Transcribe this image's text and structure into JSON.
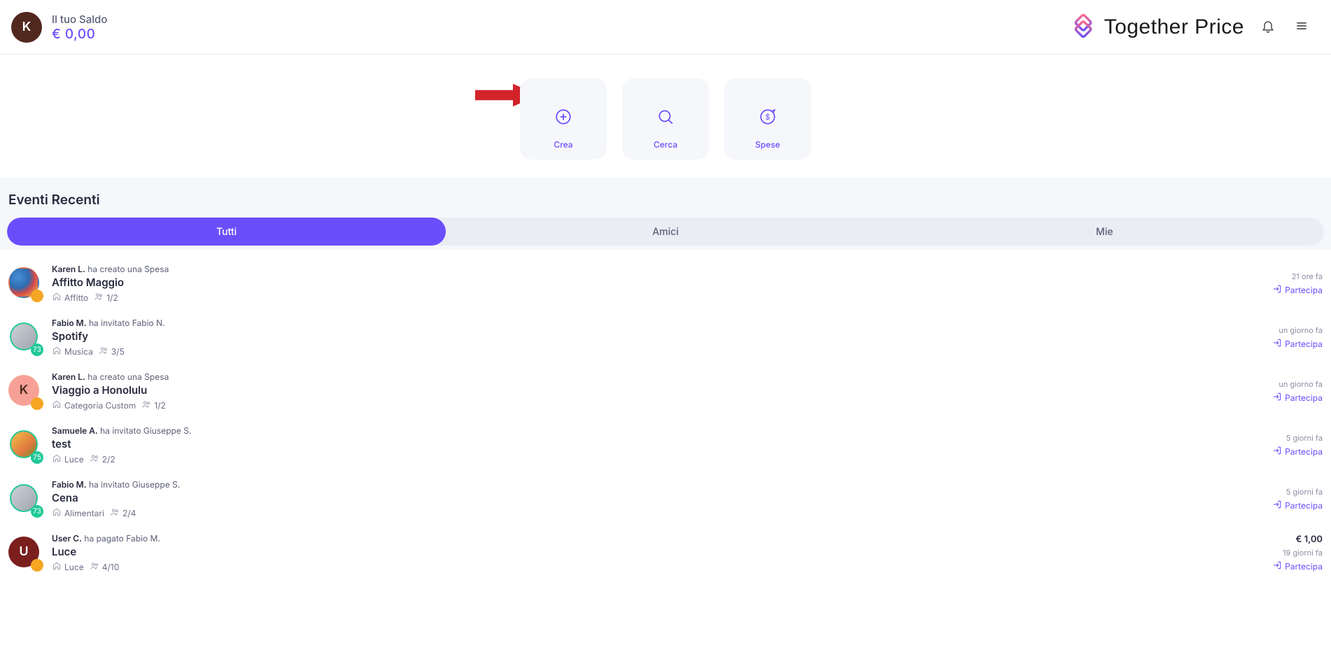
{
  "header": {
    "avatar_initial": "K",
    "balance_label": "Il tuo Saldo",
    "balance_value": "€ 0,00",
    "brand": "Together Price"
  },
  "actions": {
    "create": "Crea",
    "search": "Cerca",
    "expenses": "Spese"
  },
  "events": {
    "section_title": "Eventi Recenti",
    "tabs": {
      "all": "Tutti",
      "friends": "Amici",
      "mine": "Mie"
    },
    "participate_label": "Partecipa",
    "items": [
      {
        "actor": "Karen L.",
        "verb": "ha creato una Spesa",
        "title": "Affitto Maggio",
        "category": "Affitto",
        "members": "1/2",
        "time": "21 ore fa",
        "avatar_style": "img1",
        "badge_style": "orange",
        "badge_text": ""
      },
      {
        "actor": "Fabio M.",
        "verb": "ha invitato Fabio N.",
        "title": "Spotify",
        "category": "Musica",
        "members": "3/5",
        "time": "un giorno fa",
        "avatar_style": "img2",
        "badge_style": "green",
        "badge_text": "73",
        "ring": true
      },
      {
        "actor": "Karen L.",
        "verb": "ha creato una Spesa",
        "title": "Viaggio a Honolulu",
        "category": "Categoria Custom",
        "members": "1/2",
        "time": "un giorno fa",
        "avatar_style": "k",
        "avatar_text": "K",
        "badge_style": "orange",
        "badge_text": ""
      },
      {
        "actor": "Samuele A.",
        "verb": "ha invitato Giuseppe S.",
        "title": "test",
        "category": "Luce",
        "members": "2/2",
        "time": "5 giorni fa",
        "avatar_style": "img3",
        "badge_style": "green",
        "badge_text": "75",
        "ring": true
      },
      {
        "actor": "Fabio M.",
        "verb": "ha invitato Giuseppe S.",
        "title": "Cena",
        "category": "Alimentari",
        "members": "2/4",
        "time": "5 giorni fa",
        "avatar_style": "img2",
        "badge_style": "green",
        "badge_text": "73",
        "ring": true
      },
      {
        "actor": "User C.",
        "verb": "ha pagato Fabio M.",
        "title": "Luce",
        "category": "Luce",
        "members": "4/10",
        "time": "19 giorni fa",
        "amount": "€ 1,00",
        "avatar_style": "u",
        "avatar_text": "U",
        "badge_style": "orange",
        "badge_text": ""
      }
    ]
  }
}
